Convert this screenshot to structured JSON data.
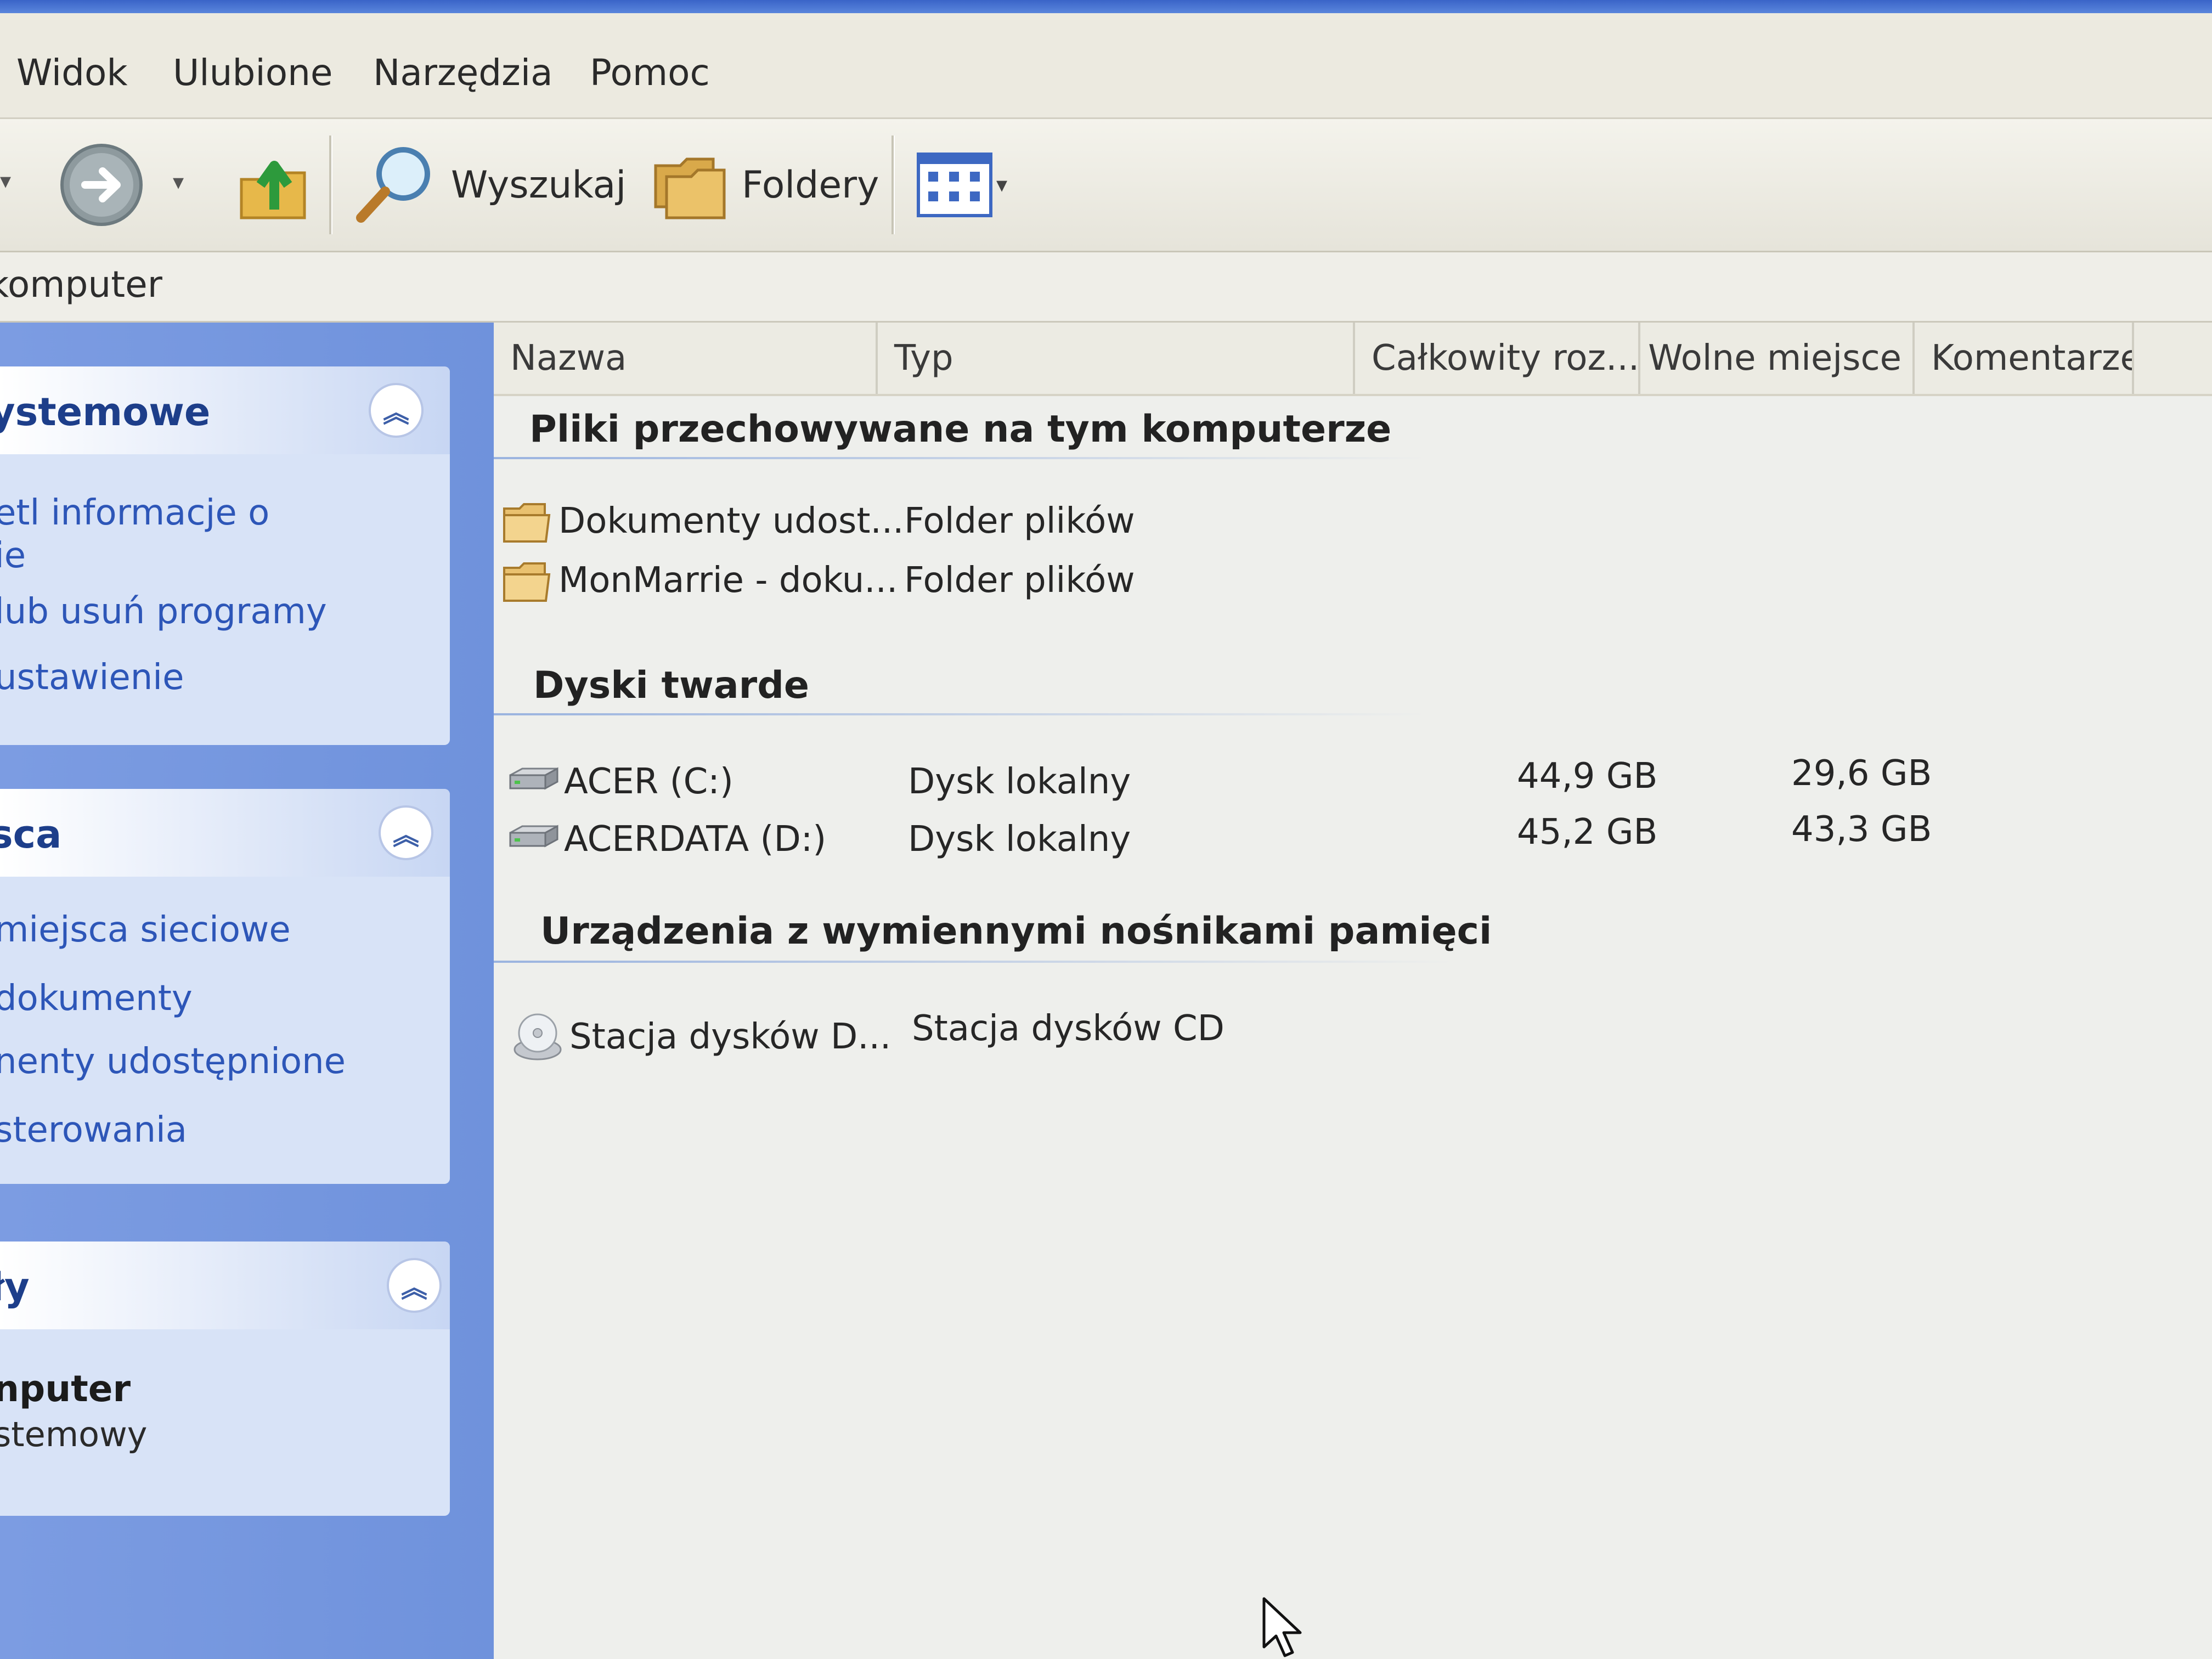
{
  "menubar": {
    "items": [
      "Widok",
      "Ulubione",
      "Narzędzia",
      "Pomoc"
    ]
  },
  "toolbar": {
    "search_label": "Wyszukaj",
    "folders_label": "Foldery"
  },
  "address": {
    "value": "komputer"
  },
  "taskpane": {
    "system_panel": {
      "title": "ystemowe",
      "links": [
        "etl informacje o",
        "ie",
        "lub usuń programy",
        "ustawienie"
      ]
    },
    "places_panel": {
      "title": "sca",
      "links": [
        "miejsca sieciowe",
        "dokumenty",
        "nenty udostępnione",
        "sterowania"
      ]
    },
    "details_panel": {
      "title": "ły",
      "name": "nputer",
      "subtitle": "stemowy"
    }
  },
  "listview": {
    "columns": [
      "Nazwa",
      "Typ",
      "Całkowity roz...",
      "Wolne miejsce",
      "Komentarze"
    ],
    "groups": [
      {
        "title": "Pliki przechowywane na tym komputerze",
        "items": [
          {
            "name": "Dokumenty udost...",
            "type": "Folder plików",
            "total": "",
            "free": "",
            "icon": "folder-icon"
          },
          {
            "name": "MonMarrie - doku...",
            "type": "Folder plików",
            "total": "",
            "free": "",
            "icon": "folder-icon"
          }
        ]
      },
      {
        "title": "Dyski twarde",
        "items": [
          {
            "name": "ACER (C:)",
            "type": "Dysk lokalny",
            "total": "44,9 GB",
            "free": "29,6 GB",
            "icon": "hard-drive-icon"
          },
          {
            "name": "ACERDATA (D:)",
            "type": "Dysk lokalny",
            "total": "45,2 GB",
            "free": "43,3 GB",
            "icon": "hard-drive-icon"
          }
        ]
      },
      {
        "title": "Urządzenia z wymiennymi nośnikami pamięci",
        "items": [
          {
            "name": "Stacja dysków D...",
            "type": "Stacja dysków CD",
            "total": "",
            "free": "",
            "icon": "cd-drive-icon"
          }
        ]
      }
    ]
  }
}
